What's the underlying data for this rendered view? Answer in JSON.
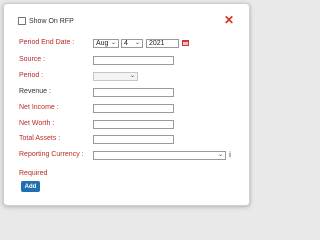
{
  "dialog": {
    "show_on_rfp_label": "Show On RFP",
    "close_symbol": "✕",
    "period_end_date": {
      "label": "Period End Date :",
      "month": "Aug",
      "day": "4",
      "year": "2021"
    },
    "source": {
      "label": "Source :",
      "value": ""
    },
    "period": {
      "label": "Period :",
      "value": ""
    },
    "revenue": {
      "label": "Revenue :",
      "value": ""
    },
    "net_income": {
      "label": "Net Income :",
      "value": ""
    },
    "net_worth": {
      "label": "Net Worth :",
      "value": ""
    },
    "total_assets": {
      "label": "Total Assets :",
      "value": ""
    },
    "reporting_currency": {
      "label": "Reporting Currency :",
      "value": ""
    },
    "required_label": "Required",
    "add_label": "Add",
    "info_symbol": "i"
  },
  "colors": {
    "required_red": "#b82b2b",
    "button_blue": "#1f6fb2",
    "close_red": "#d9301e"
  },
  "icons": {
    "close": "close-icon",
    "calendar": "calendar-icon",
    "info": "info-icon",
    "chevron": "chevron-down-icon"
  }
}
